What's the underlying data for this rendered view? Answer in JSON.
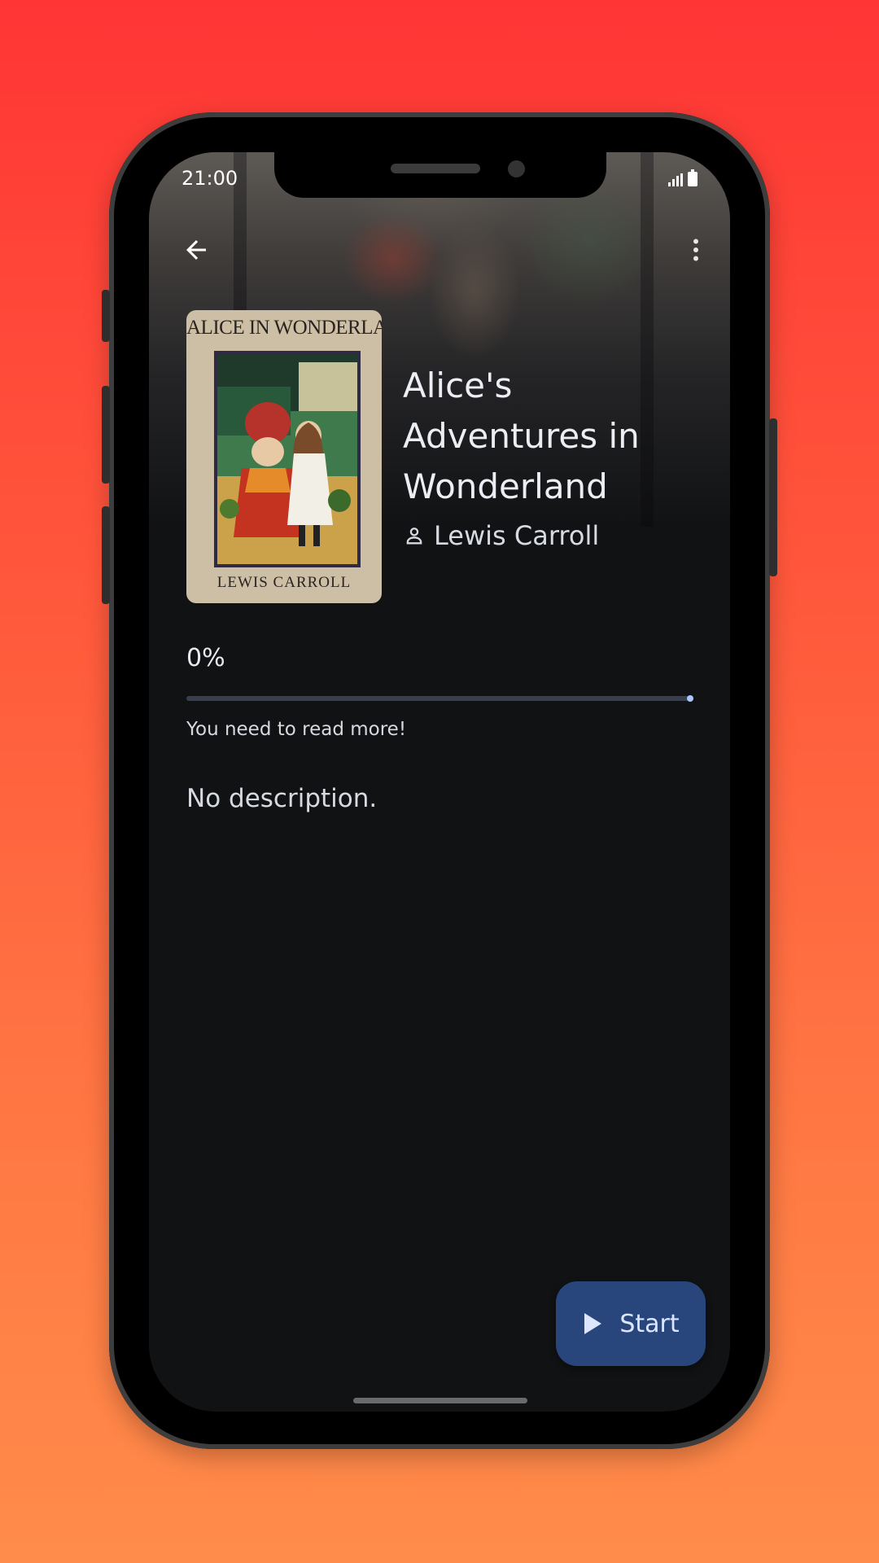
{
  "status_bar": {
    "time": "21:00",
    "signal_icon": "signal-icon",
    "battery_icon": "battery-icon"
  },
  "toolbar": {
    "back_icon": "arrow-back-icon",
    "menu_icon": "more-vert-icon"
  },
  "book": {
    "cover": {
      "title": "ALICE IN WONDERLAND",
      "author": "LEWIS CARROLL"
    },
    "title": "Alice's Adventures in Wonderland",
    "author": "Lewis Carroll",
    "author_icon": "person-icon"
  },
  "progress": {
    "percent_text": "0%",
    "value": 1.0,
    "note": "You need to read more!"
  },
  "description": "No description.",
  "fab": {
    "label": "Start",
    "icon": "play-icon"
  },
  "colors": {
    "accent": "#aac7ff",
    "fab_bg": "#28467c",
    "surface": "#111214"
  }
}
